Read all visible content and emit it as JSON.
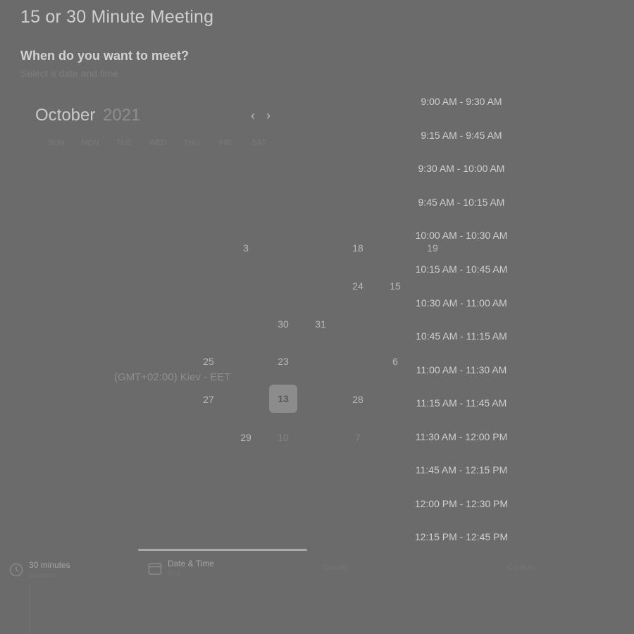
{
  "page": {
    "title": "15 or 30 Minute Meeting",
    "question": "When do you want to meet?",
    "subtext": "Select a date and time"
  },
  "calendar": {
    "month": "October",
    "year": "2021",
    "prev_label": "‹",
    "next_label": "›",
    "weekdays": [
      "SUN",
      "MON",
      "TUE",
      "WED",
      "THU",
      "FRI",
      "SAT"
    ],
    "visible_days": [
      "3",
      "18",
      "19",
      "24",
      "15",
      "30",
      "31",
      "25",
      "23",
      "6",
      "27",
      "13",
      "28",
      "29",
      "10",
      "7"
    ],
    "selected_day": "13"
  },
  "timezone": "(GMT+02:00) Kiev - EET",
  "time_slots": [
    "9:00 AM - 9:30 AM",
    "9:15 AM - 9:45 AM",
    "9:30 AM - 10:00 AM",
    "9:45 AM - 10:15 AM",
    "10:00 AM - 10:30 AM",
    "10:15 AM - 10:45 AM",
    "10:30 AM - 11:00 AM",
    "10:45 AM - 11:15 AM",
    "11:00 AM - 11:30 AM",
    "11:15 AM - 11:45 AM",
    "11:30 AM - 12:00 PM",
    "11:45 AM - 12:15 PM",
    "12:00 PM - 12:30 PM",
    "12:15 PM - 12:45 PM"
  ],
  "steps": {
    "duration": {
      "title": "30 minutes",
      "sub": "Duration"
    },
    "datetime": {
      "title": "Date & Time",
      "sub": "Pick"
    },
    "details": {
      "title": "Details"
    },
    "confirm": {
      "title": "Confirm"
    }
  },
  "progress": 0.4
}
